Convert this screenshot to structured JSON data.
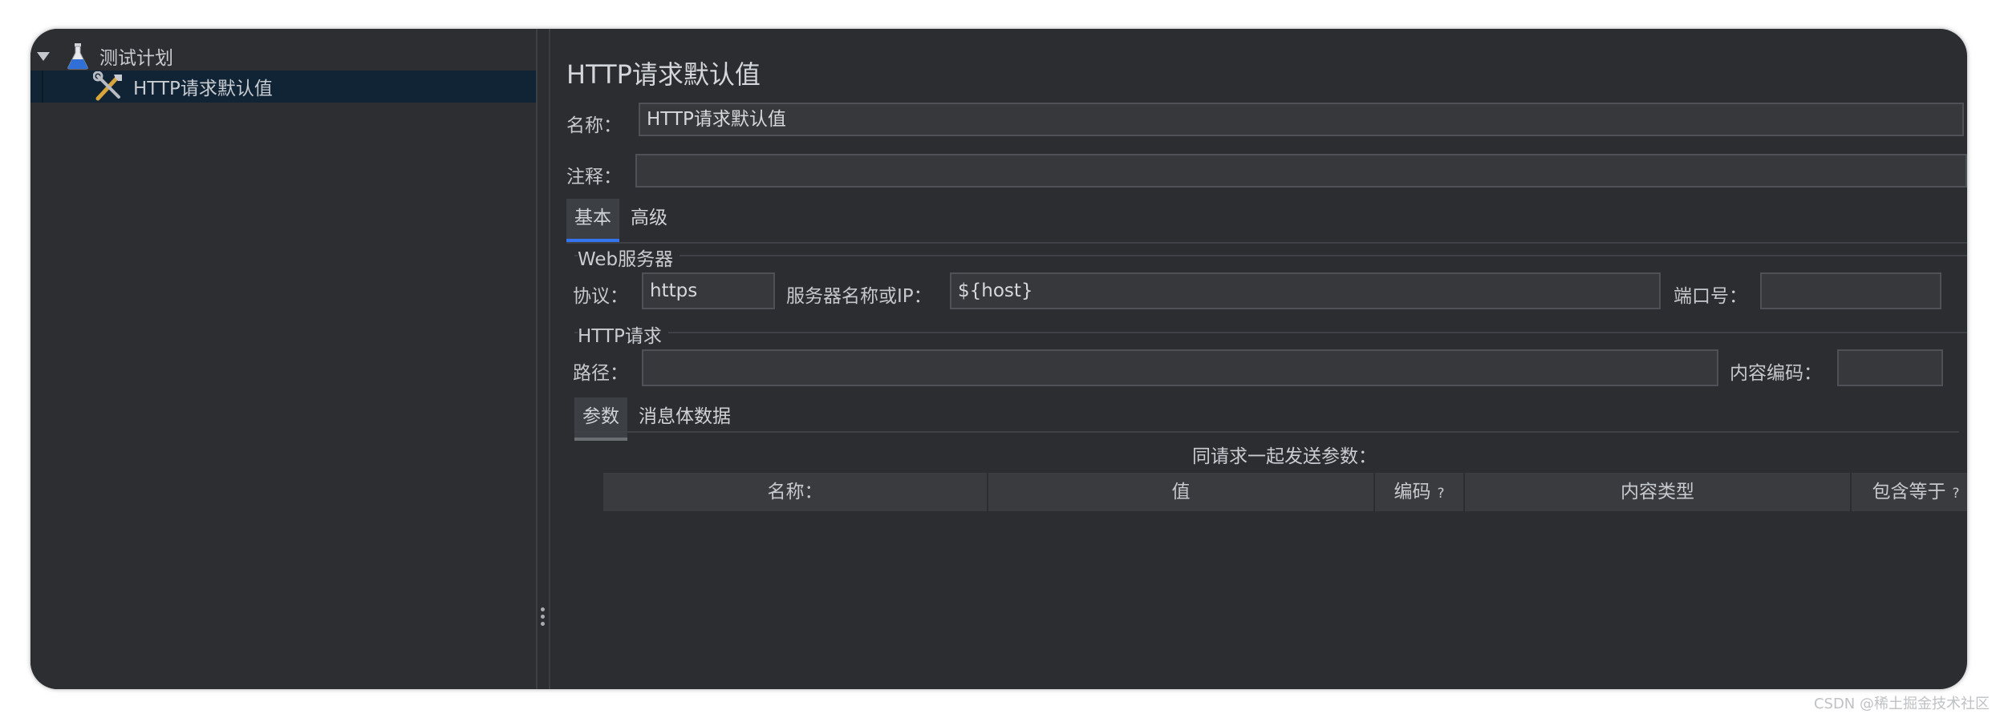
{
  "tree": {
    "root_label": "测试计划",
    "child_label": "HTTP请求默认值"
  },
  "panel": {
    "title": "HTTP请求默认值",
    "name_label": "名称：",
    "name_value": "HTTP请求默认值",
    "comment_label": "注释：",
    "comment_value": "",
    "tabs": [
      "基本",
      "高级"
    ],
    "web_server": {
      "group_title": "Web服务器",
      "protocol_label": "协议：",
      "protocol_value": "https",
      "server_label": "服务器名称或IP：",
      "server_value": "${host}",
      "port_label": "端口号：",
      "port_value": ""
    },
    "http_request": {
      "group_title": "HTTP请求",
      "path_label": "路径：",
      "path_value": "",
      "encoding_label": "内容编码：",
      "encoding_value": ""
    },
    "sub_tabs": [
      "参数",
      "消息体数据"
    ],
    "params_caption": "同请求一起发送参数：",
    "table_headers": [
      {
        "label": "名称：",
        "help": ""
      },
      {
        "label": "值",
        "help": ""
      },
      {
        "label": "编码",
        "help": "?"
      },
      {
        "label": "内容类型",
        "help": ""
      },
      {
        "label": "包含等于",
        "help": "?"
      }
    ]
  },
  "watermark": "CSDN @稀土掘金技术社区"
}
